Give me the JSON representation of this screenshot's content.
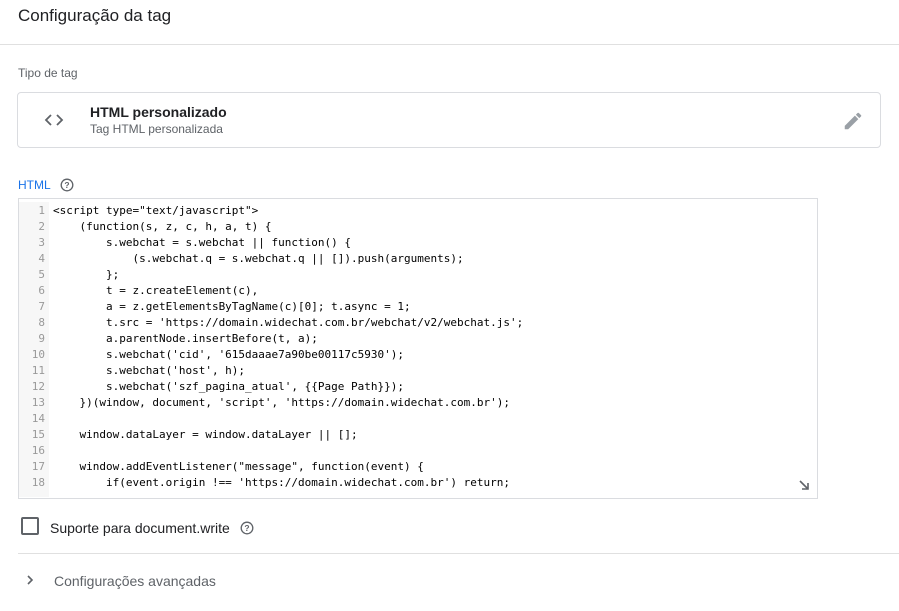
{
  "header": {
    "title": "Configuração da tag"
  },
  "tag_type": {
    "section_label": "Tipo de tag",
    "name": "HTML personalizado",
    "subtitle": "Tag HTML personalizada"
  },
  "html_editor": {
    "label": "HTML",
    "lines": [
      {
        "n": "1",
        "text": "<script type=\"text/javascript\">"
      },
      {
        "n": "2",
        "text": "    (function(s, z, c, h, a, t) {"
      },
      {
        "n": "3",
        "text": "        s.webchat = s.webchat || function() {"
      },
      {
        "n": "4",
        "text": "            (s.webchat.q = s.webchat.q || []).push(arguments);"
      },
      {
        "n": "5",
        "text": "        };"
      },
      {
        "n": "6",
        "text": "        t = z.createElement(c),"
      },
      {
        "n": "7",
        "text": "        a = z.getElementsByTagName(c)[0]; t.async = 1;"
      },
      {
        "n": "8",
        "text": "        t.src = 'https://domain.widechat.com.br/webchat/v2/webchat.js';"
      },
      {
        "n": "9",
        "text": "        a.parentNode.insertBefore(t, a);"
      },
      {
        "n": "10",
        "text": "        s.webchat('cid', '615daaae7a90be00117c5930');"
      },
      {
        "n": "11",
        "text": "        s.webchat('host', h);"
      },
      {
        "n": "12",
        "text": "        s.webchat('szf_pagina_atual', {{Page Path}});"
      },
      {
        "n": "13",
        "text": "    })(window, document, 'script', 'https://domain.widechat.com.br');"
      },
      {
        "n": "14",
        "text": ""
      },
      {
        "n": "15",
        "text": "    window.dataLayer = window.dataLayer || [];"
      },
      {
        "n": "16",
        "text": ""
      },
      {
        "n": "17",
        "text": "    window.addEventListener(\"message\", function(event) {"
      },
      {
        "n": "18",
        "text": "        if(event.origin !== 'https://domain.widechat.com.br') return;"
      }
    ]
  },
  "document_write": {
    "label": "Suporte para document.write",
    "checked": false
  },
  "advanced": {
    "label": "Configurações avançadas"
  },
  "colors": {
    "accent": "#1a73e8",
    "text": "#202124",
    "muted": "#5f6368",
    "border": "#dadce0"
  }
}
